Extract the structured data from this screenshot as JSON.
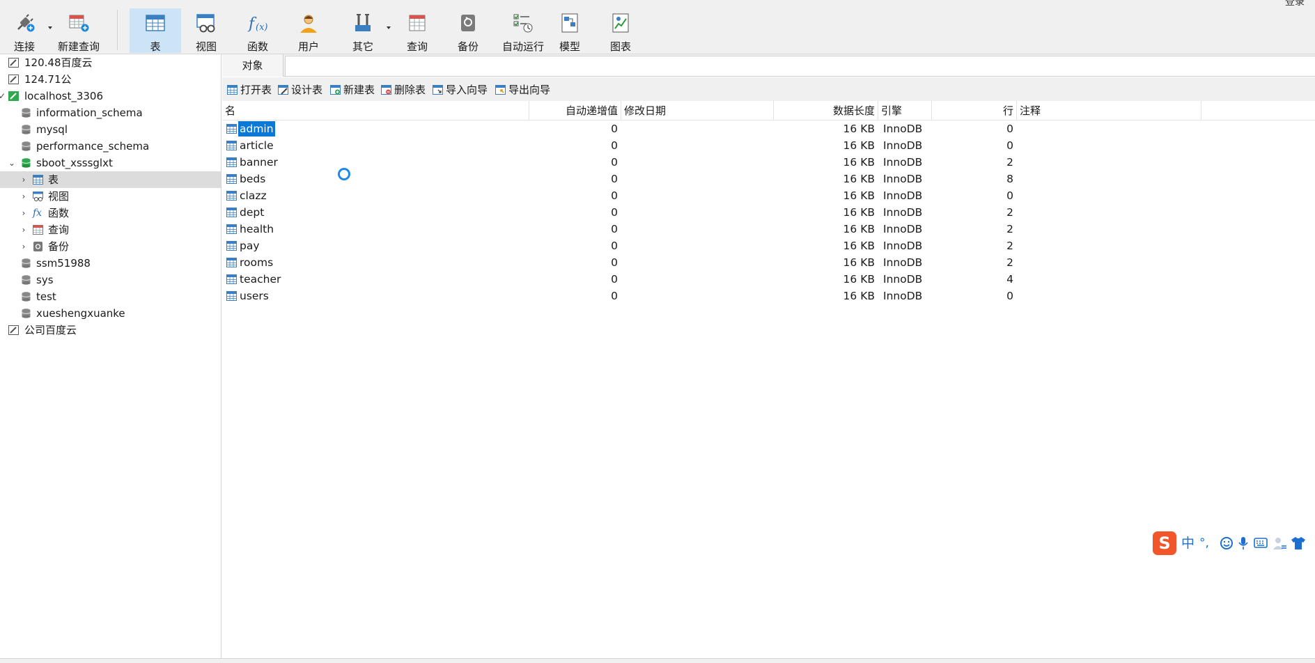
{
  "window": {
    "menu_fragment": "登录"
  },
  "toolbar": {
    "connect": "连接",
    "new_query": "新建查询",
    "table": "表",
    "view": "视图",
    "function": "函数",
    "user": "用户",
    "other": "其它",
    "query": "查询",
    "backup": "备份",
    "automation": "自动运行",
    "model": "模型",
    "chart": "图表"
  },
  "sidebar": {
    "items": [
      {
        "label": "120.48百度云"
      },
      {
        "label": "124.71公"
      },
      {
        "label": "localhost_3306"
      },
      {
        "label": "information_schema"
      },
      {
        "label": "mysql"
      },
      {
        "label": "performance_schema"
      },
      {
        "label": "sboot_xsssglxt"
      },
      {
        "label": "表"
      },
      {
        "label": "视图"
      },
      {
        "label": "函数"
      },
      {
        "label": "查询"
      },
      {
        "label": "备份"
      },
      {
        "label": "ssm51988"
      },
      {
        "label": "sys"
      },
      {
        "label": "test"
      },
      {
        "label": "xueshengxuanke"
      },
      {
        "label": "公司百度云"
      }
    ],
    "fx_glyph": "fx"
  },
  "tabs": {
    "objects": "对象"
  },
  "actions": {
    "open_table": "打开表",
    "design_table": "设计表",
    "new_table": "新建表",
    "delete_table": "删除表",
    "import_wizard": "导入向导",
    "export_wizard": "导出向导"
  },
  "grid": {
    "columns": {
      "name": "名",
      "auto_increment": "自动递增值",
      "modified": "修改日期",
      "data_length": "数据长度",
      "engine": "引擎",
      "rows": "行",
      "comment": "注释"
    },
    "rows": [
      {
        "name": "admin",
        "auto_increment": "0",
        "modified": "",
        "data_length": "16 KB",
        "engine": "InnoDB",
        "rows": "0",
        "comment": ""
      },
      {
        "name": "article",
        "auto_increment": "0",
        "modified": "",
        "data_length": "16 KB",
        "engine": "InnoDB",
        "rows": "0",
        "comment": ""
      },
      {
        "name": "banner",
        "auto_increment": "0",
        "modified": "",
        "data_length": "16 KB",
        "engine": "InnoDB",
        "rows": "2",
        "comment": ""
      },
      {
        "name": "beds",
        "auto_increment": "0",
        "modified": "",
        "data_length": "16 KB",
        "engine": "InnoDB",
        "rows": "8",
        "comment": ""
      },
      {
        "name": "clazz",
        "auto_increment": "0",
        "modified": "",
        "data_length": "16 KB",
        "engine": "InnoDB",
        "rows": "0",
        "comment": ""
      },
      {
        "name": "dept",
        "auto_increment": "0",
        "modified": "",
        "data_length": "16 KB",
        "engine": "InnoDB",
        "rows": "2",
        "comment": ""
      },
      {
        "name": "health",
        "auto_increment": "0",
        "modified": "",
        "data_length": "16 KB",
        "engine": "InnoDB",
        "rows": "2",
        "comment": ""
      },
      {
        "name": "pay",
        "auto_increment": "0",
        "modified": "",
        "data_length": "16 KB",
        "engine": "InnoDB",
        "rows": "2",
        "comment": ""
      },
      {
        "name": "rooms",
        "auto_increment": "0",
        "modified": "",
        "data_length": "16 KB",
        "engine": "InnoDB",
        "rows": "2",
        "comment": ""
      },
      {
        "name": "teacher",
        "auto_increment": "0",
        "modified": "",
        "data_length": "16 KB",
        "engine": "InnoDB",
        "rows": "4",
        "comment": ""
      },
      {
        "name": "users",
        "auto_increment": "0",
        "modified": "",
        "data_length": "16 KB",
        "engine": "InnoDB",
        "rows": "0",
        "comment": ""
      }
    ]
  },
  "ime": {
    "logo": "S",
    "mode": "中",
    "punct": "°,"
  },
  "colors": {
    "selection": "#0a78d4",
    "toolbar_active": "#cde3f6",
    "spinner": "#1e88e5",
    "ime_logo": "#f0562a"
  }
}
